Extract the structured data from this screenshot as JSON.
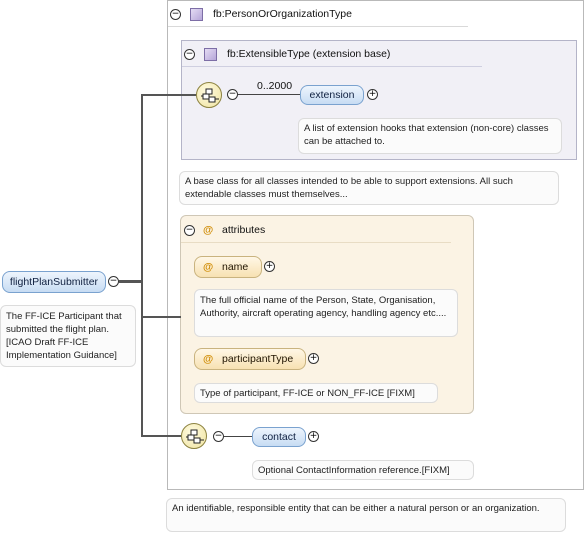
{
  "root": {
    "label": "flightPlanSubmitter",
    "doc": "The FF-ICE Participant that submitted the flight plan. [ICAO Draft FF-ICE Implementation Guidance]"
  },
  "type_box": {
    "title": "fb:PersonOrOrganizationType",
    "doc": "An identifiable, responsible entity that can be either a natural person or an organization."
  },
  "extension_base": {
    "title": "fb:ExtensibleType (extension base)",
    "multiplicity": "0..2000",
    "element_label": "extension",
    "element_doc": "A list of extension hooks that extension (non-core) classes can be attached to.",
    "doc": "A base class for all classes intended to be able to support extensions. All such extendable classes must themselves..."
  },
  "attributes": {
    "title": "attributes",
    "symbol": "@",
    "items": [
      {
        "label": "name",
        "doc": "The full official name of the Person, State, Organisation, Authority, aircraft operating agency, handling agency etc...."
      },
      {
        "label": "participantType",
        "doc": "Type of participant, FF-ICE or NON_FF-ICE [FIXM]"
      }
    ]
  },
  "contact": {
    "label": "contact",
    "doc": "Optional ContactInformation reference.[FIXM]"
  },
  "symbols": {
    "collapse": "−",
    "expand": "+"
  },
  "colors": {
    "element_fill": "#c7dcf3",
    "attribute_fill": "#f7e1b2",
    "compositor_fill": "#efe3a0"
  }
}
